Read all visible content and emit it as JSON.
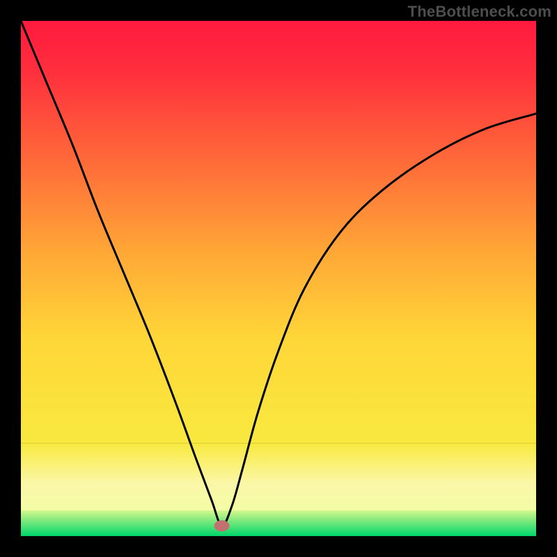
{
  "watermark": "TheBottleneck.com",
  "chart_data": {
    "type": "line",
    "title": "",
    "xlabel": "",
    "ylabel": "",
    "xlim": [
      0,
      100
    ],
    "ylim": [
      0,
      100
    ],
    "grid": false,
    "legend": false,
    "background": {
      "top_color": "#ff1a40",
      "mid_color": "#ffe03a",
      "bottom_color": "#00e676",
      "bottom_band_color": "#f7faa0"
    },
    "marker": {
      "x": 39,
      "y": 2,
      "color": "#c27070"
    },
    "series": [
      {
        "name": "bottleneck-curve",
        "x": [
          0,
          5,
          10,
          15,
          20,
          25,
          30,
          34,
          37,
          39,
          41,
          43,
          46,
          50,
          55,
          62,
          70,
          80,
          90,
          100
        ],
        "values": [
          100,
          88,
          76,
          63,
          51,
          39,
          26,
          15,
          7,
          2,
          6,
          13,
          24,
          36,
          48,
          59,
          67,
          74,
          79,
          82
        ]
      }
    ]
  }
}
